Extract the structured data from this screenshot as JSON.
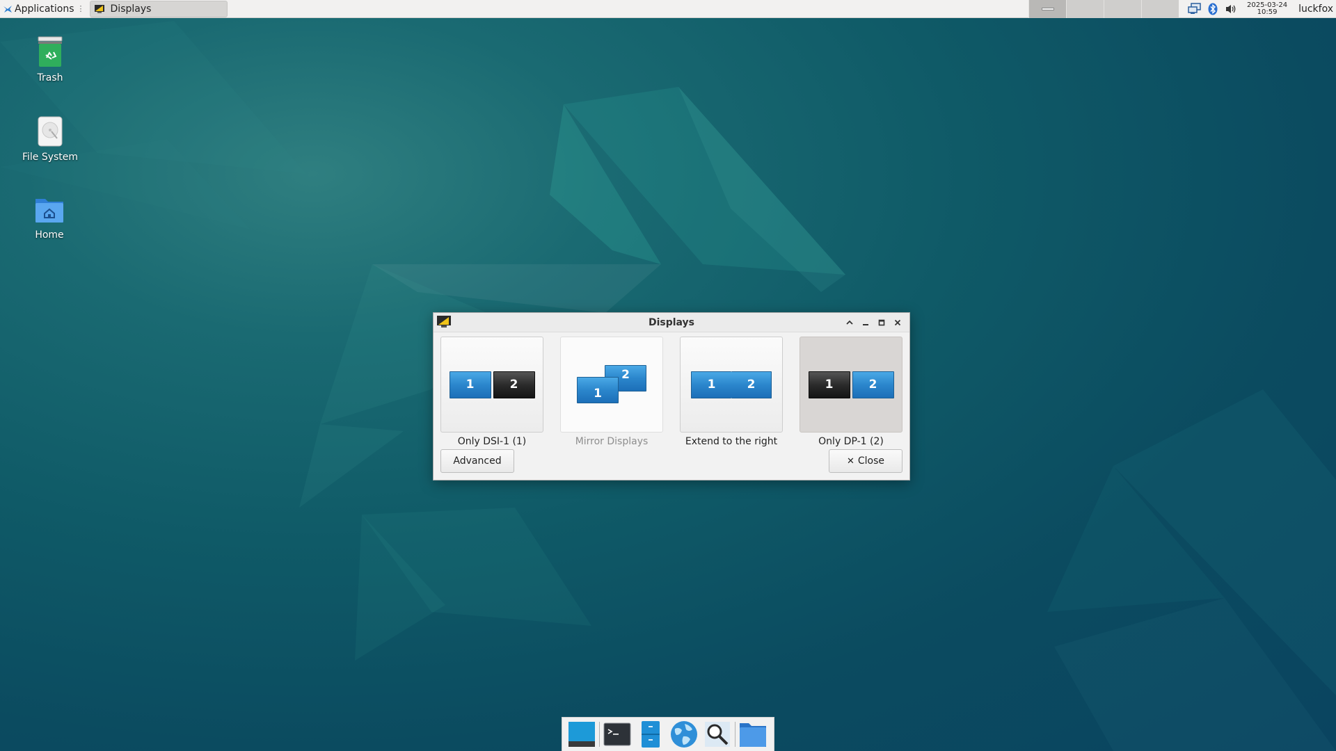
{
  "panel": {
    "applications_label": "Applications",
    "task_title": "Displays",
    "clock_date": "2025-03-24",
    "clock_time": "10:59",
    "username": "luckfox"
  },
  "desktop": {
    "icons": [
      {
        "label": "Trash",
        "icon": "trash-icon"
      },
      {
        "label": "File System",
        "icon": "drive-icon"
      },
      {
        "label": "Home",
        "icon": "home-folder-icon"
      }
    ]
  },
  "dialog": {
    "title": "Displays",
    "options": [
      {
        "label": "Only DSI-1 (1)",
        "screen1": "1",
        "screen2": "2",
        "state": "normal"
      },
      {
        "label": "Mirror Displays",
        "screen1": "1",
        "screen2": "2",
        "state": "disabled"
      },
      {
        "label": "Extend to the right",
        "screen1": "1",
        "screen2": "2",
        "state": "normal"
      },
      {
        "label": "Only DP-1 (2)",
        "screen1": "1",
        "screen2": "2",
        "state": "selected"
      }
    ],
    "advanced_label": "Advanced",
    "close_label": "Close",
    "close_glyph": "✕"
  },
  "dock": {
    "items": [
      "show-desktop-icon",
      "terminal-icon",
      "file-manager-icon",
      "web-browser-icon",
      "app-finder-icon",
      "home-folder-icon"
    ]
  },
  "colors": {
    "desktop_bg": "#0f5a67",
    "screen_on": "#2b86cc",
    "screen_off": "#2b2b2b",
    "panel_bg": "#f2f1f0"
  }
}
